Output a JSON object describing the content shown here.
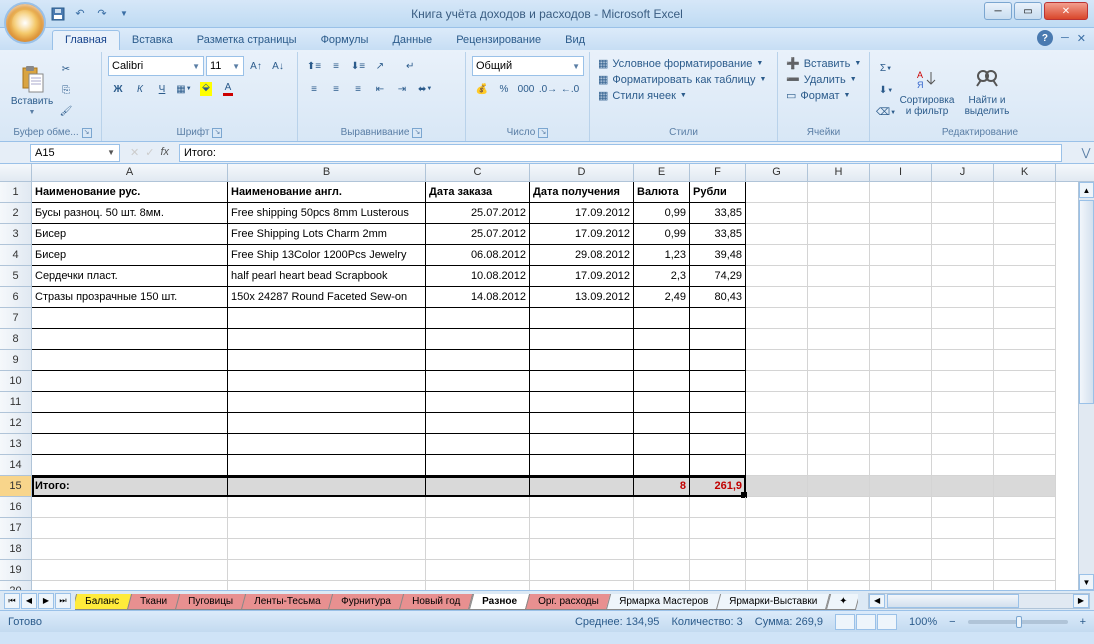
{
  "window": {
    "title": "Книга учёта доходов и расходов - Microsoft Excel"
  },
  "tabs": {
    "home": "Главная",
    "insert": "Вставка",
    "layout": "Разметка страницы",
    "formulas": "Формулы",
    "data": "Данные",
    "review": "Рецензирование",
    "view": "Вид"
  },
  "ribbon": {
    "clipboard": {
      "label": "Буфер обме...",
      "paste": "Вставить"
    },
    "font": {
      "label": "Шрифт",
      "name": "Calibri",
      "size": "11",
      "b": "Ж",
      "i": "К",
      "u": "Ч"
    },
    "align": {
      "label": "Выравнивание"
    },
    "number": {
      "label": "Число",
      "format": "Общий"
    },
    "styles": {
      "label": "Стили",
      "cond": "Условное форматирование",
      "table": "Форматировать как таблицу",
      "cell": "Стили ячеек"
    },
    "cells": {
      "label": "Ячейки",
      "ins": "Вставить",
      "del": "Удалить",
      "fmt": "Формат"
    },
    "editing": {
      "label": "Редактирование",
      "sort": "Сортировка и фильтр",
      "find": "Найти и выделить"
    }
  },
  "namebox": "A15",
  "formula": "Итого:",
  "cols": {
    "A": 196,
    "B": 198,
    "C": 104,
    "D": 104,
    "E": 56,
    "F": 56,
    "G": 62,
    "H": 62,
    "I": 62,
    "J": 62,
    "K": 62
  },
  "headers": [
    "Наименование рус.",
    "Наименование англ.",
    "Дата заказа",
    "Дата получения",
    "Валюта",
    "Рубли"
  ],
  "rows": [
    {
      "n": "Бусы разноц. 50 шт. 8мм.",
      "e": "Free shipping 50pcs 8mm Lusterous",
      "d1": "25.07.2012",
      "d2": "17.09.2012",
      "v": "0,99",
      "r": "33,85"
    },
    {
      "n": "Бисер",
      "e": "Free Shipping Lots Charm 2mm",
      "d1": "25.07.2012",
      "d2": "17.09.2012",
      "v": "0,99",
      "r": "33,85"
    },
    {
      "n": "Бисер",
      "e": "Free Ship 13Color 1200Pcs Jewelry",
      "d1": "06.08.2012",
      "d2": "29.08.2012",
      "v": "1,23",
      "r": "39,48"
    },
    {
      "n": "Сердечки пласт.",
      "e": "half pearl heart bead Scrapbook",
      "d1": "10.08.2012",
      "d2": "17.09.2012",
      "v": "2,3",
      "r": "74,29"
    },
    {
      "n": "Стразы прозрачные 150 шт.",
      "e": "150x 24287 Round Faceted Sew-on",
      "d1": "14.08.2012",
      "d2": "13.09.2012",
      "v": "2,49",
      "r": "80,43"
    }
  ],
  "total": {
    "label": "Итого:",
    "v": "8",
    "r": "261,9"
  },
  "sheets": [
    "Баланс",
    "Ткани",
    "Пуговицы",
    "Ленты-Тесьма",
    "Фурнитура",
    "Новый год",
    "Разное",
    "Орг. расходы",
    "Ярмарка Мастеров",
    "Ярмарки-Выставки"
  ],
  "active_sheet": 6,
  "status": {
    "ready": "Готово",
    "avg_l": "Среднее:",
    "avg_v": "134,95",
    "cnt_l": "Количество:",
    "cnt_v": "3",
    "sum_l": "Сумма:",
    "sum_v": "269,9",
    "zoom": "100%"
  }
}
